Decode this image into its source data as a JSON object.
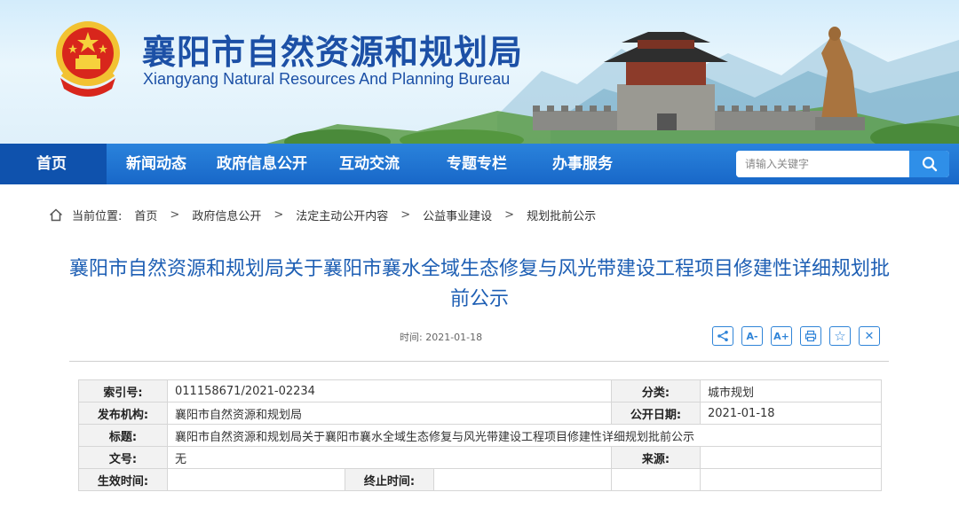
{
  "site": {
    "title": "襄阳市自然资源和规划局",
    "subtitle": "Xiangyang Natural Resources And Planning Bureau"
  },
  "nav": {
    "items": [
      {
        "label": "首页",
        "active": true
      },
      {
        "label": "新闻动态"
      },
      {
        "label": "政府信息公开"
      },
      {
        "label": "互动交流"
      },
      {
        "label": "专题专栏"
      },
      {
        "label": "办事服务"
      }
    ],
    "search": {
      "placeholder": "请输入关键字"
    }
  },
  "breadcrumb": {
    "label": "当前位置:",
    "items": [
      "首页",
      "政府信息公开",
      "法定主动公开内容",
      "公益事业建设",
      "规划批前公示"
    ],
    "separator": ">"
  },
  "article": {
    "title": "襄阳市自然资源和规划局关于襄阳市襄水全域生态修复与风光带建设工程项目修建性详细规划批前公示",
    "time_label": "时间:",
    "time": "2021-01-18",
    "tools": [
      {
        "icon": "share-icon",
        "glyph": "<"
      },
      {
        "icon": "font-decrease-icon",
        "glyph": "A-"
      },
      {
        "icon": "font-increase-icon",
        "glyph": "A+"
      },
      {
        "icon": "print-icon",
        "glyph": "⎙"
      },
      {
        "icon": "favorite-icon",
        "glyph": "☆"
      },
      {
        "icon": "close-icon",
        "glyph": "✕"
      }
    ]
  },
  "info_table": {
    "index_label": "索引号:",
    "index_value": "011158671/2021-02234",
    "category_label": "分类:",
    "category_value": "城市规划",
    "publisher_label": "发布机构:",
    "publisher_value": "襄阳市自然资源和规划局",
    "publish_date_label": "公开日期:",
    "publish_date_value": "2021-01-18",
    "subject_label": "标题:",
    "subject_value": "襄阳市自然资源和规划局关于襄阳市襄水全域生态修复与风光带建设工程项目修建性详细规划批前公示",
    "doc_no_label": "文号:",
    "doc_no_value": "无",
    "source_label": "来源:",
    "source_value": "",
    "effective_label": "生效时间:",
    "effective_value": "",
    "expire_label": "终止时间:",
    "expire_value": ""
  },
  "colors": {
    "brand_blue": "#1c50a6",
    "nav_blue": "#1867c8",
    "nav_home": "#0f52ad",
    "title_blue": "#1e5fb4"
  }
}
